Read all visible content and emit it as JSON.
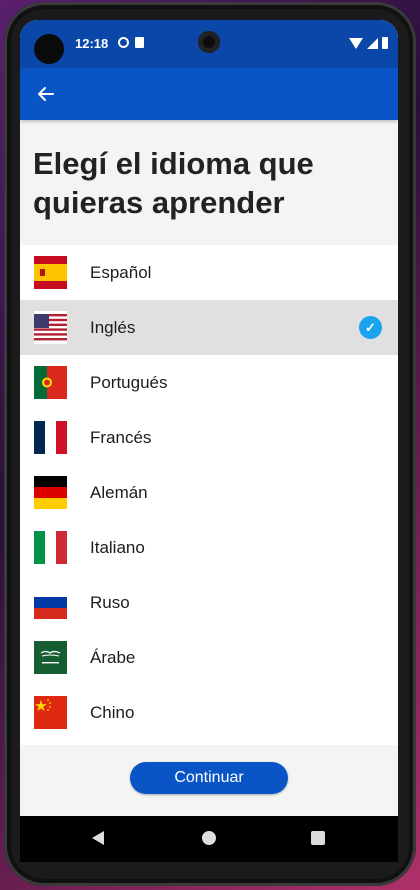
{
  "status_bar": {
    "time": "12:18"
  },
  "app_bar": {
    "back_icon": "arrow-left-icon"
  },
  "page": {
    "title": "Elegí el idioma que quieras aprender"
  },
  "languages": [
    {
      "label": "Español",
      "flag": "spain-flag-icon",
      "selected": false
    },
    {
      "label": "Inglés",
      "flag": "usa-flag-icon",
      "selected": true
    },
    {
      "label": "Portugués",
      "flag": "portugal-flag-icon",
      "selected": false
    },
    {
      "label": "Francés",
      "flag": "france-flag-icon",
      "selected": false
    },
    {
      "label": "Alemán",
      "flag": "germany-flag-icon",
      "selected": false
    },
    {
      "label": "Italiano",
      "flag": "italy-flag-icon",
      "selected": false
    },
    {
      "label": "Ruso",
      "flag": "russia-flag-icon",
      "selected": false
    },
    {
      "label": "Árabe",
      "flag": "saudi-arabia-flag-icon",
      "selected": false
    },
    {
      "label": "Chino",
      "flag": "china-flag-icon",
      "selected": false
    }
  ],
  "actions": {
    "continue_label": "Continuar"
  },
  "colors": {
    "primary": "#0a55c6",
    "status": "#0a47a8",
    "check": "#1aa3ef",
    "selected_row": "#e0e0e0"
  }
}
